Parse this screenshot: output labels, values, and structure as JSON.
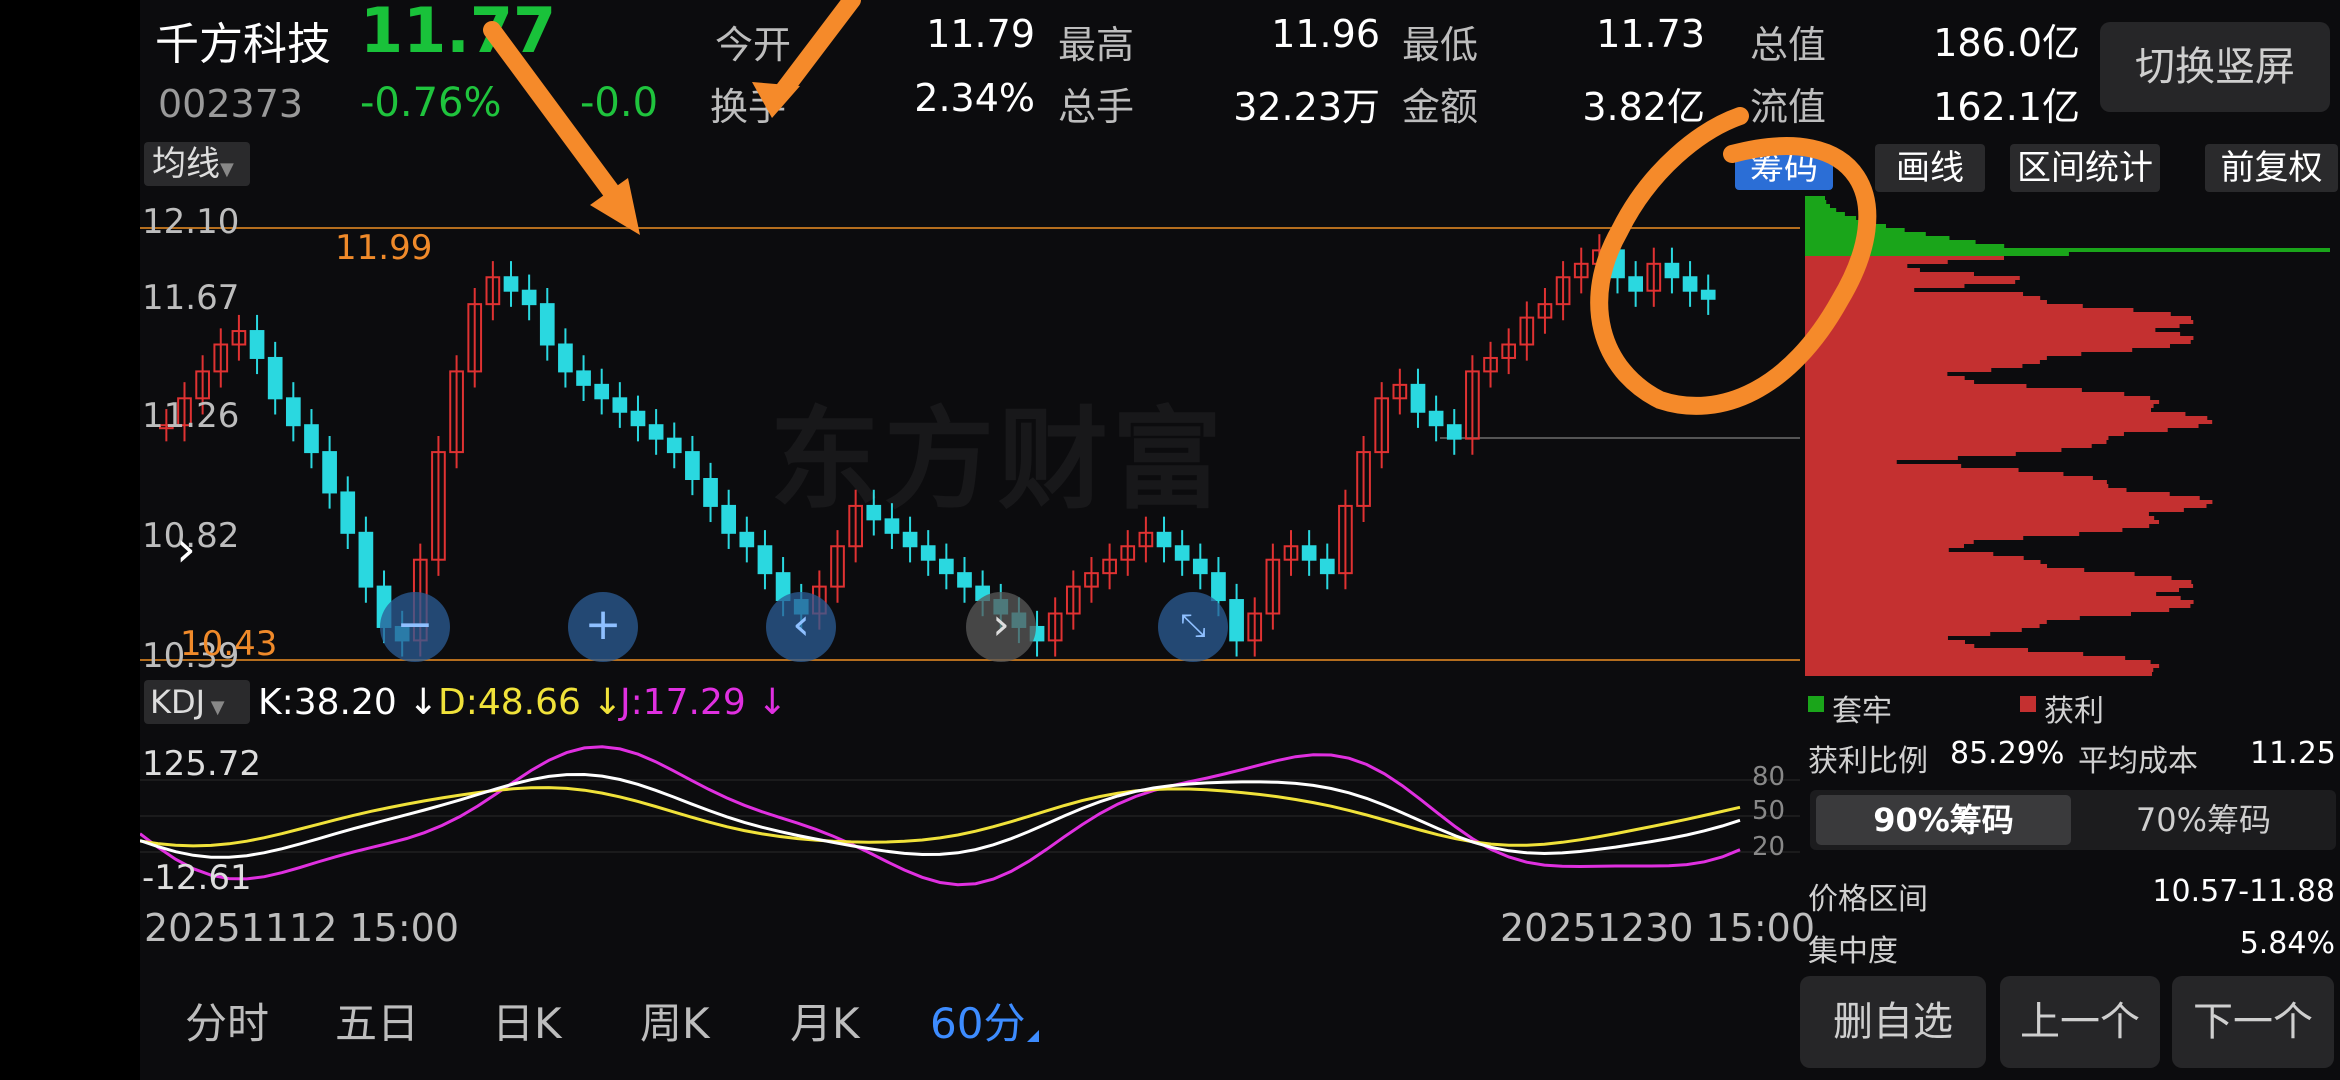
{
  "header": {
    "stock_name": "千方科技",
    "price": "11.77",
    "code": "002373",
    "change_pct": "-0.76%",
    "change_abs": "-0.0",
    "open_label": "今开",
    "open_value": "11.79",
    "high_label": "最高",
    "high_value": "11.96",
    "low_label": "最低",
    "low_value": "11.73",
    "total_cap_label": "总值",
    "total_cap_value": "186.0亿",
    "turnover_label": "换手",
    "turnover_value": "2.34%",
    "volume_label": "总手",
    "volume_value": "32.23万",
    "amount_label": "金额",
    "amount_value": "3.82亿",
    "float_cap_label": "流值",
    "float_cap_value": "162.1亿",
    "switch_button": "切换竖屏"
  },
  "toolbar": {
    "ma_label": "均线",
    "chip_tab": "筹码",
    "draw_button": "画线",
    "range_stat_button": "区间统计",
    "adjust_button": "前复权"
  },
  "main_chart": {
    "y_top": "12.10",
    "y_2": "11.67",
    "y_3": "11.26",
    "y_4": "10.82",
    "y_bottom": "10.39",
    "high_marker": "11.99",
    "low_marker": "10.43",
    "watermark": "东方财富"
  },
  "kdj": {
    "name": "KDJ",
    "k": "K:38.20 ↓",
    "d": "D:48.66 ↓",
    "j": "J:17.29 ↓",
    "y_top": "125.72",
    "y_bottom": "-12.61",
    "lvl80": "80",
    "lvl50": "50",
    "lvl20": "20"
  },
  "time_axis": {
    "start": "20251112 15:00",
    "end": "20251230 15:00"
  },
  "period_tabs": [
    "分时",
    "五日",
    "日K",
    "周K",
    "月K",
    "60分"
  ],
  "chip_panel": {
    "legend_trapped": "套牢",
    "legend_profit": "获利",
    "profit_ratio_label": "获利比例",
    "profit_ratio_value": "85.29%",
    "avg_cost_label": "平均成本",
    "avg_cost_value": "11.25",
    "tab_90": "90%筹码",
    "tab_70": "70%筹码",
    "price_range_label": "价格区间",
    "price_range_value": "10.57-11.88",
    "concentration_label": "集中度",
    "concentration_value": "5.84%",
    "trapped_color": "#1aa51a",
    "profit_color": "#c43030"
  },
  "bottom_buttons": {
    "remove": "删自选",
    "prev": "上一个",
    "next": "下一个"
  },
  "chart_data": {
    "type": "candlestick",
    "series_close": [
      11.3,
      11.4,
      11.5,
      11.6,
      11.65,
      11.55,
      11.4,
      11.3,
      11.2,
      11.05,
      10.9,
      10.7,
      10.55,
      10.5,
      10.8,
      11.2,
      11.5,
      11.75,
      11.85,
      11.8,
      11.75,
      11.6,
      11.5,
      11.45,
      11.4,
      11.35,
      11.3,
      11.25,
      11.2,
      11.1,
      11.0,
      10.9,
      10.85,
      10.75,
      10.65,
      10.6,
      10.7,
      10.85,
      11.0,
      10.95,
      10.9,
      10.85,
      10.8,
      10.75,
      10.7,
      10.65,
      10.6,
      10.55,
      10.5,
      10.6,
      10.7,
      10.75,
      10.8,
      10.85,
      10.9,
      10.85,
      10.8,
      10.75,
      10.65,
      10.5,
      10.6,
      10.8,
      10.85,
      10.8,
      10.75,
      11.0,
      11.2,
      11.4,
      11.45,
      11.35,
      11.3,
      11.25,
      11.5,
      11.55,
      11.6,
      11.7,
      11.75,
      11.85,
      11.9,
      11.95,
      11.85,
      11.8,
      11.9,
      11.85,
      11.8,
      11.77
    ]
  },
  "colors": {
    "up": "#e03232",
    "down": "#2ad8e0",
    "accent_blue": "#2b6ed6",
    "annotation": "#f58a2a"
  }
}
